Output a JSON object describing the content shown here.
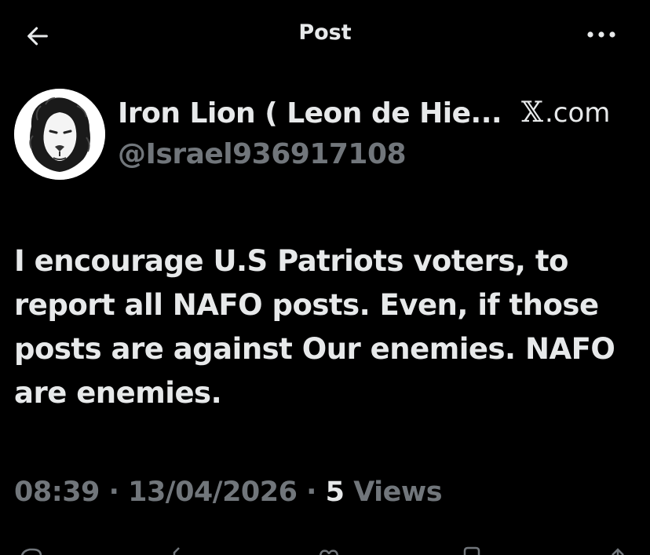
{
  "header": {
    "title": "Post",
    "back_icon": "arrow-left-icon",
    "more_icon": "more-horizontal-icon"
  },
  "author": {
    "display_name": "Iron Lion ( Leon de Hie...",
    "handle": "@Israel936917108",
    "avatar_icon": "lion-avatar"
  },
  "source": {
    "label": ".com",
    "icon": "x-logo-icon"
  },
  "tweet": {
    "text": "I encourage U.S Patriots voters, to report all NAFO posts. Even, if those posts are against Our enemies. NAFO are enemies."
  },
  "meta": {
    "time": "08:39",
    "sep1": " · ",
    "date": "13/04/2026",
    "sep2": " · ",
    "views_count": "5",
    "views_label": " Views"
  },
  "actions": [
    "reply-icon",
    "repost-icon",
    "like-icon",
    "bookmark-icon",
    "share-icon"
  ],
  "colors": {
    "background": "#000000",
    "primary_text": "#e7e9ea",
    "secondary_text": "#71767b"
  }
}
